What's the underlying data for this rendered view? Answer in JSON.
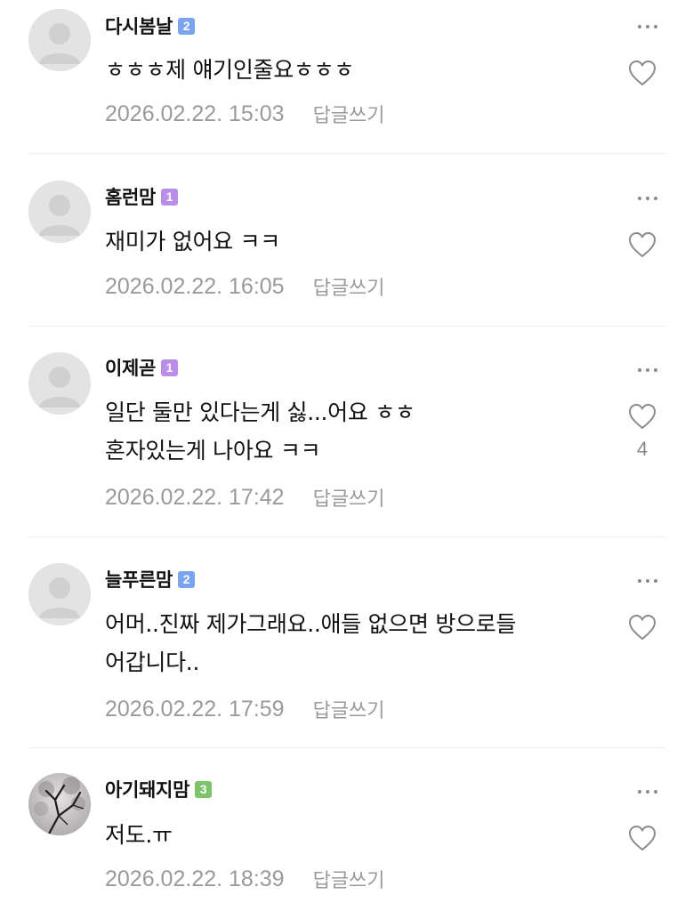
{
  "comments": [
    {
      "author": "다시봄날",
      "level": "2",
      "level_color": "#7aa3f0",
      "text": "ㅎㅎㅎ제 얘기인줄요ㅎㅎㅎ",
      "date": "2026.02.22. 15:03",
      "reply_label": "답글쓰기",
      "likes": "",
      "avatar_icon": "default-user-icon"
    },
    {
      "author": "홈런맘",
      "level": "1",
      "level_color": "#b98de8",
      "text": "재미가 없어요 ㅋㅋ",
      "date": "2026.02.22. 16:05",
      "reply_label": "답글쓰기",
      "likes": "",
      "avatar_icon": "default-user-icon"
    },
    {
      "author": "이제곧",
      "level": "1",
      "level_color": "#b98de8",
      "text": "일단 둘만 있다는게 싫...어요 ㅎㅎ\n혼자있는게 나아요 ㅋㅋ",
      "date": "2026.02.22. 17:42",
      "reply_label": "답글쓰기",
      "likes": "4",
      "avatar_icon": "default-user-icon"
    },
    {
      "author": "늘푸른맘",
      "level": "2",
      "level_color": "#7aa3f0",
      "text": "어머..진짜 제가그래요..애들 없으면 방으로들\n어갑니다..",
      "date": "2026.02.22. 17:59",
      "reply_label": "답글쓰기",
      "likes": "",
      "avatar_icon": "default-user-icon"
    },
    {
      "author": "아기돼지맘",
      "level": "3",
      "level_color": "#7cc46a",
      "text": "저도.ㅠ",
      "date": "2026.02.22. 18:39",
      "reply_label": "답글쓰기",
      "likes": "",
      "avatar_icon": "tree-branch-photo-avatar"
    }
  ]
}
